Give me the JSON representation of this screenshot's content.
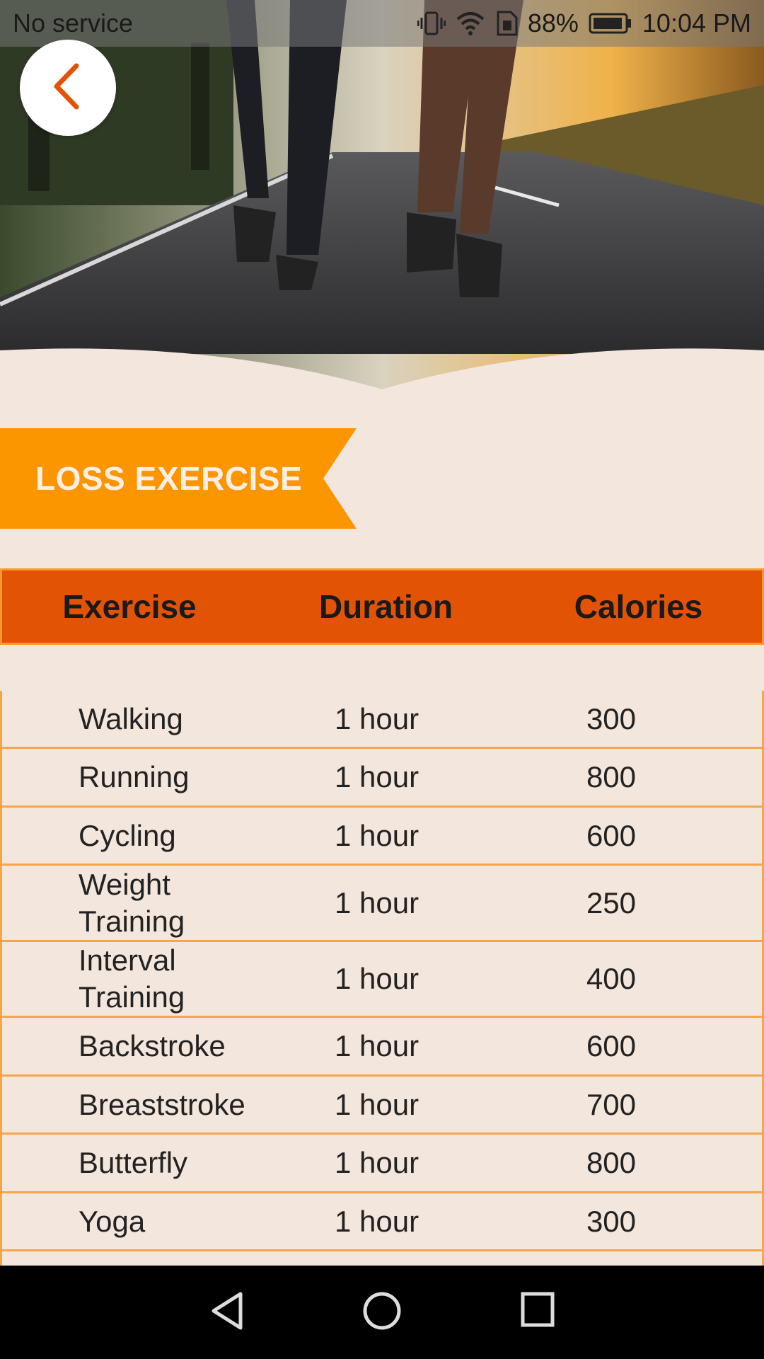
{
  "status_bar": {
    "carrier": "No service",
    "battery_percent": "88%",
    "time": "10:04 PM",
    "icons": [
      "vibrate-icon",
      "wifi-icon",
      "sim-icon",
      "battery-icon"
    ]
  },
  "hero": {
    "description_icon": "runners-photo"
  },
  "back_button": {
    "icon": "chevron-left-icon",
    "accent": "#e35305"
  },
  "ribbon": {
    "label": "LOSS EXERCISE",
    "color": "#fb9500"
  },
  "table": {
    "headers": [
      "Exercise",
      "Duration",
      "Calories"
    ],
    "header_color": "#e35305",
    "rows": [
      {
        "exercise": "Walking",
        "duration": "1 hour",
        "calories": "300"
      },
      {
        "exercise": "Running",
        "duration": "1 hour",
        "calories": "800"
      },
      {
        "exercise": "Cycling",
        "duration": "1 hour",
        "calories": "600"
      },
      {
        "exercise": "Weight Training",
        "duration": "1 hour",
        "calories": "250"
      },
      {
        "exercise": "Interval Training",
        "duration": "1 hour",
        "calories": "400"
      },
      {
        "exercise": "Backstroke",
        "duration": "1 hour",
        "calories": "600"
      },
      {
        "exercise": "Breaststroke",
        "duration": "1 hour",
        "calories": "700"
      },
      {
        "exercise": "Butterfly",
        "duration": "1 hour",
        "calories": "800"
      },
      {
        "exercise": "Yoga",
        "duration": "1 hour",
        "calories": "300"
      },
      {
        "exercise": "",
        "duration": "",
        "calories": ""
      }
    ]
  },
  "nav_bar": {
    "icons": [
      "back-triangle-icon",
      "home-circle-icon",
      "recents-square-icon"
    ]
  }
}
